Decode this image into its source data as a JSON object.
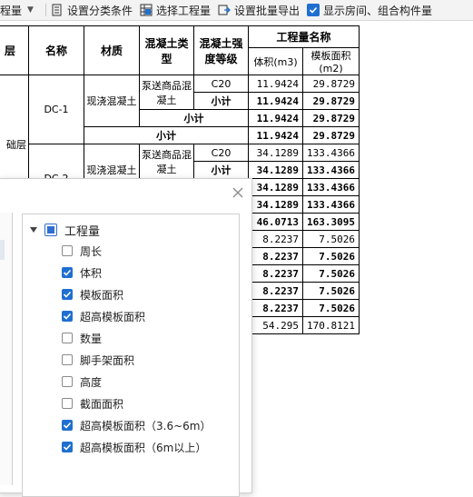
{
  "toolbar": {
    "dropdown_text": "程量",
    "set_category": "设置分类条件",
    "select_quantity": "选择工程量",
    "batch_export": "设置批量导出",
    "show_room": "显示房间、组合构件量"
  },
  "table": {
    "headers": {
      "floor": "层",
      "name": "名称",
      "material": "材质",
      "concrete_type": "混凝土类型",
      "concrete_grade": "混凝土强度等级",
      "quantity_name": "工程量名称",
      "volume": "体积(m3)",
      "formwork": "模板面积(m2)"
    },
    "floor_label": "础层",
    "subtotal": "小计",
    "g1": {
      "name": "DC-1",
      "material": "现浇混凝土",
      "ctype": "泵送商品混凝土",
      "grade": "C20",
      "vol": "11.9424",
      "form": "29.8729",
      "sub1_vol": "11.9424",
      "sub1_form": "29.8729",
      "sub2_vol": "11.9424",
      "sub2_form": "29.8729",
      "sub3_vol": "11.9424",
      "sub3_form": "29.8729"
    },
    "g2": {
      "name": "DC-2",
      "material": "现浇混凝土",
      "ctype": "泵送商品混凝土",
      "grade": "C20",
      "vol": "34.1289",
      "form": "133.4366",
      "sub1_vol": "34.1289",
      "sub1_form": "133.4366"
    },
    "extra_rows": [
      {
        "vol": "34.1289",
        "form": "133.4366",
        "bold": true
      },
      {
        "vol": "34.1289",
        "form": "133.4366",
        "bold": true
      },
      {
        "vol": "46.0713",
        "form": "163.3095",
        "bold": true
      },
      {
        "vol": "8.2237",
        "form": "7.5026",
        "bold": false
      },
      {
        "vol": "8.2237",
        "form": "7.5026",
        "bold": true
      },
      {
        "vol": "8.2237",
        "form": "7.5026",
        "bold": true
      },
      {
        "vol": "8.2237",
        "form": "7.5026",
        "bold": true
      },
      {
        "vol": "8.2237",
        "form": "7.5026",
        "bold": true
      },
      {
        "vol": "54.295",
        "form": "170.8121",
        "bold": false
      }
    ]
  },
  "dialog": {
    "root_label": "工程量",
    "items": [
      {
        "label": "周长",
        "checked": false
      },
      {
        "label": "体积",
        "checked": true
      },
      {
        "label": "模板面积",
        "checked": true
      },
      {
        "label": "超高模板面积",
        "checked": true
      },
      {
        "label": "数量",
        "checked": false
      },
      {
        "label": "脚手架面积",
        "checked": false
      },
      {
        "label": "高度",
        "checked": false
      },
      {
        "label": "截面面积",
        "checked": false
      },
      {
        "label": "超高模板面积（3.6~6m）",
        "checked": true
      },
      {
        "label": "超高模板面积（6m以上）",
        "checked": true
      }
    ]
  },
  "colors": {
    "accent": "#1f6fd1",
    "border": "#000000",
    "toolbar_bg": "#f3f3f3"
  }
}
